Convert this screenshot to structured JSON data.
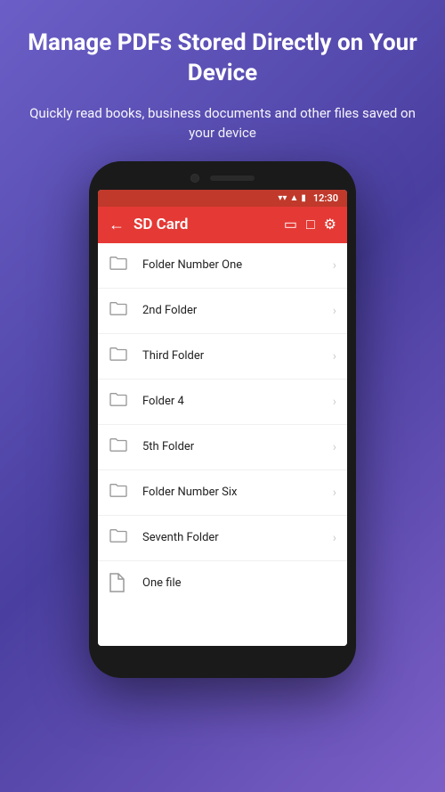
{
  "header": {
    "title": "Manage PDFs Stored Directly on Your Device",
    "subtitle": "Quickly read books, business documents and other files saved on your device"
  },
  "statusBar": {
    "time": "12:30",
    "wifiIcon": "▼",
    "signalIcon": "▲",
    "batteryIcon": "▮"
  },
  "toolbar": {
    "backLabel": "←",
    "title": "SD Card",
    "icon1": "⬚",
    "icon2": "⬒",
    "icon3": "⚙"
  },
  "files": [
    {
      "name": "Folder Number One",
      "type": "folder"
    },
    {
      "name": "2nd Folder",
      "type": "folder"
    },
    {
      "name": "Third Folder",
      "type": "folder"
    },
    {
      "name": "Folder 4",
      "type": "folder"
    },
    {
      "name": "5th Folder",
      "type": "folder"
    },
    {
      "name": "Folder Number Six",
      "type": "folder"
    },
    {
      "name": "Seventh Folder",
      "type": "folder"
    },
    {
      "name": "One file",
      "type": "file"
    }
  ]
}
